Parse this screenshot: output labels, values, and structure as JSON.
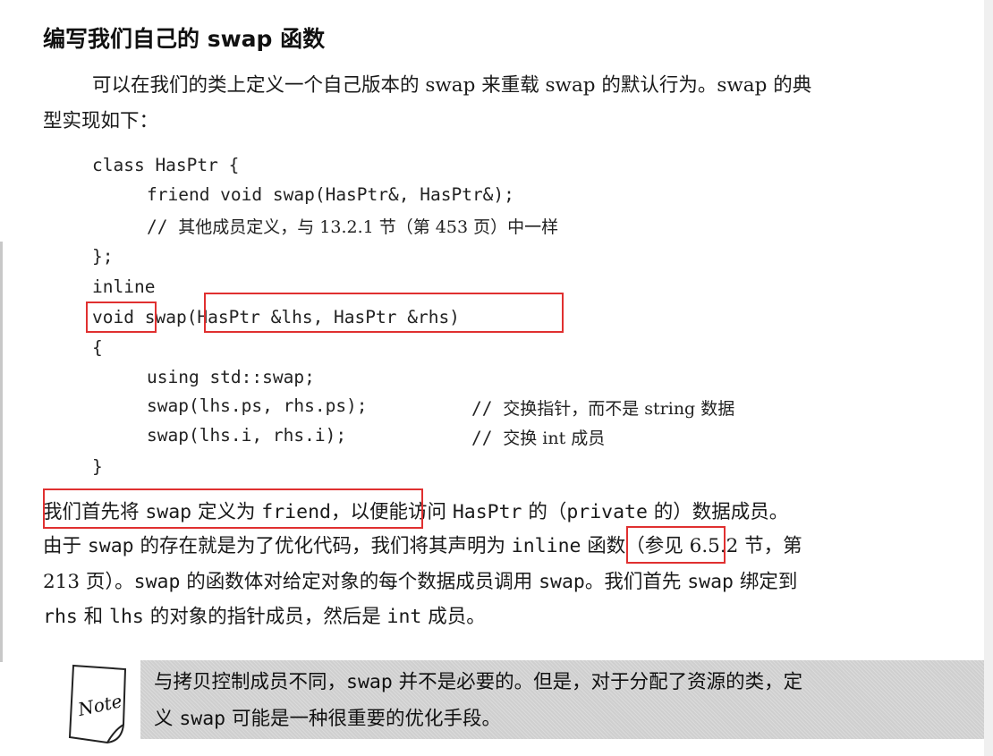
{
  "heading": "编写我们自己的 swap 函数",
  "intro": {
    "line1": "可以在我们的类上定义一个自己版本的 swap 来重载 swap 的默认行为。swap 的典",
    "line2": "型实现如下："
  },
  "code": {
    "l1": "class HasPtr {",
    "l2": "friend void swap(HasPtr&, HasPtr&);",
    "l3_prefix": "// ",
    "l3_comment": "其他成员定义，与 13.2.1 节（第 453 页）中一样",
    "l4": "};",
    "l5": "inline",
    "l6_void": "void",
    "l6_name": "swap",
    "l6_params": "(HasPtr &lhs, HasPtr &rhs)",
    "l7": "{",
    "l8": "using std::swap;",
    "l9_code": "swap(lhs.ps, rhs.ps);",
    "l9_prefix": "// ",
    "l9_comment": "交换指针，而不是 string 数据",
    "l10_code": "swap(lhs.i, rhs.i);",
    "l10_prefix": "// ",
    "l10_comment": "交换 int 成员",
    "l11": "}"
  },
  "explain": {
    "p1a": "我们首先将 ",
    "p1_swap": "swap",
    "p1b": " 定义为 ",
    "p1_friend": "friend",
    "p1c": "，以便能访问 ",
    "p1_hasptr": "HasPtr",
    "p1d": " 的（",
    "p1_private": "private",
    "p1e": " 的）数据成员。",
    "p2a": "由于 ",
    "p2_swap": "swap",
    "p2b": " 的存在就是为了优化代码，我们将其声明为 ",
    "p2_inline": "inline",
    "p2c": " 函数（参见 6.5.2 节，第",
    "p3a": "213 页）。",
    "p3_swap1": "swap",
    "p3b": " 的函数体对给定对象的每个数据成员调用 ",
    "p3_swap2": "swap",
    "p3c": "。我们首先 ",
    "p3_swap3": "swap",
    "p3d": " 绑定到",
    "p4_rhs": "rhs",
    "p4a": " 和 ",
    "p4_lhs": "lhs",
    "p4b": " 的对象的指针成员，然后是 ",
    "p4_int": "int",
    "p4c": " 成员。"
  },
  "note": {
    "badge": "Note",
    "l1a": "与拷贝控制成员不同，",
    "l1_swap": "swap",
    "l1b": " 并不是必要的。但是，对于分配了资源的类，定",
    "l2a": "义 ",
    "l2_swap": "swap",
    "l2b": " 可能是一种很重要的优化手段。"
  },
  "colors": {
    "highlight_box": "#e03030",
    "note_background": "#cfcfcf"
  }
}
